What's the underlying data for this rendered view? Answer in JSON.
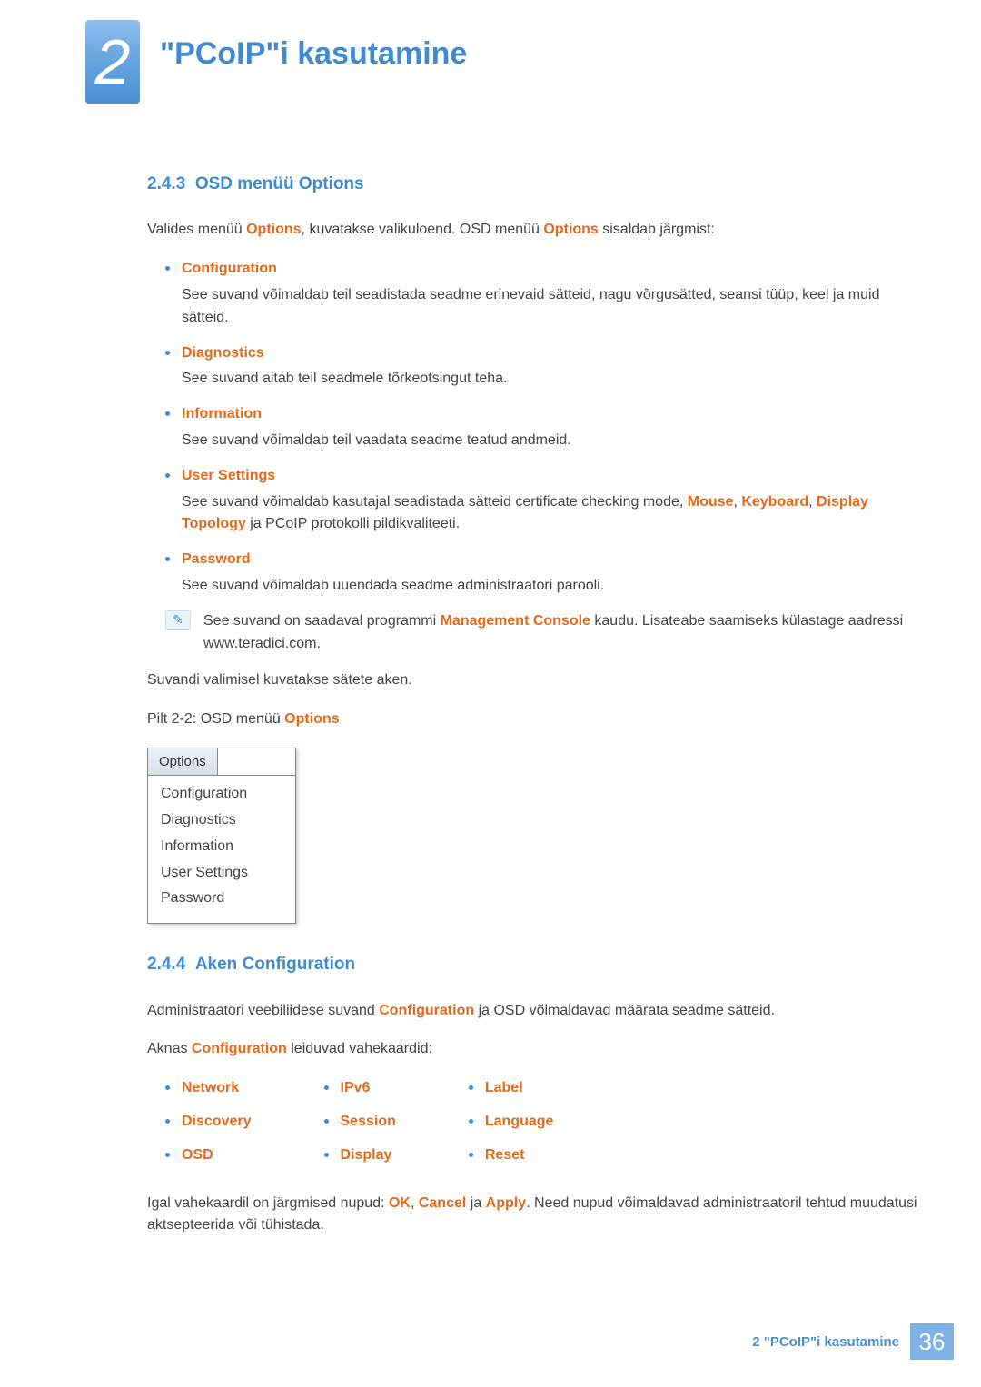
{
  "chapter": {
    "number": "2",
    "title": "\"PCoIP\"i kasutamine"
  },
  "s243": {
    "num": "2.4.3",
    "title": "OSD menüü Options",
    "intro_pre": "Valides menüü ",
    "intro_mid": ", kuvatakse valikuloend. OSD menüü ",
    "intro_post": " sisaldab järgmist:",
    "kw": "Options",
    "items": [
      {
        "t": "Configuration",
        "d": "See suvand võimaldab teil seadistada seadme erinevaid sätteid, nagu võrgusätted, seansi tüüp, keel ja muid sätteid."
      },
      {
        "t": "Diagnostics",
        "d": "See suvand aitab teil seadmele tõrkeotsingut teha."
      },
      {
        "t": "Information",
        "d": "See suvand võimaldab teil vaadata seadme teatud andmeid."
      },
      {
        "t": "User Settings",
        "d_pre": "See suvand võimaldab kasutajal seadistada sätteid certificate checking mode, ",
        "kw1": "Mouse",
        "sep1": ", ",
        "kw2": "Keyboard",
        "sep2": ", ",
        "kw3": "Display Topology",
        "d_post": " ja PCoIP protokolli pildikvaliteeti."
      },
      {
        "t": "Password",
        "d": "See suvand võimaldab uuendada seadme administraatori parooli."
      }
    ],
    "note_pre": "See suvand on saadaval programmi ",
    "note_kw": "Management Console",
    "note_post": " kaudu. Lisateabe saamiseks külastage aadressi www.teradici.com.",
    "after1": "Suvandi valimisel kuvatakse sätete aken.",
    "fig_pre": "Pilt 2-2: OSD menüü ",
    "fig_kw": "Options",
    "menu_tab": "Options",
    "menu_items": [
      "Configuration",
      "Diagnostics",
      "Information",
      "User Settings",
      "Password"
    ]
  },
  "s244": {
    "num": "2.4.4",
    "title": "Aken Configuration",
    "p1_pre": "Administraatori veebiliidese suvand ",
    "p1_kw": "Configuration",
    "p1_post": " ja OSD võimaldavad määrata seadme sätteid.",
    "p2_pre": "Aknas ",
    "p2_kw": "Configuration",
    "p2_post": " leiduvad vahekaardid:",
    "col1": [
      "Network",
      "Discovery",
      "OSD"
    ],
    "col2": [
      "IPv6",
      "Session",
      "Display"
    ],
    "col3": [
      "Label",
      "Language",
      "Reset"
    ],
    "p3_pre": "Igal vahekaardil on järgmised nupud: ",
    "p3_k1": "OK",
    "p3_s1": ", ",
    "p3_k2": "Cancel",
    "p3_s2": " ja ",
    "p3_k3": "Apply",
    "p3_post": ". Need nupud võimaldavad administraatoril tehtud muudatusi aktsepteerida või tühistada."
  },
  "footer": {
    "text": "2 \"PCoIP\"i kasutamine",
    "page": "36"
  }
}
